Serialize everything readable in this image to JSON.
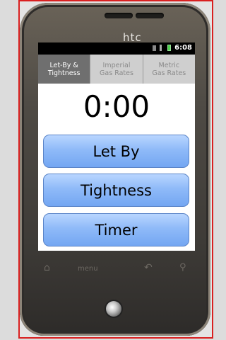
{
  "device": {
    "brand": "htc"
  },
  "statusbar": {
    "time": "6:08"
  },
  "tabs": [
    {
      "label": "Let-By &\nTightness",
      "active": true
    },
    {
      "label": "Imperial\nGas Rates",
      "active": false
    },
    {
      "label": "Metric\nGas Rates",
      "active": false
    }
  ],
  "main": {
    "timer_display": "0:00",
    "buttons": {
      "let_by": "Let By",
      "tightness": "Tightness",
      "timer": "Timer"
    }
  },
  "hardware_keys": {
    "menu_label": "menu"
  },
  "colors": {
    "button_blue": "#8fbaf8",
    "active_tab": "#6f6f6f",
    "frame_red": "#d92020"
  }
}
